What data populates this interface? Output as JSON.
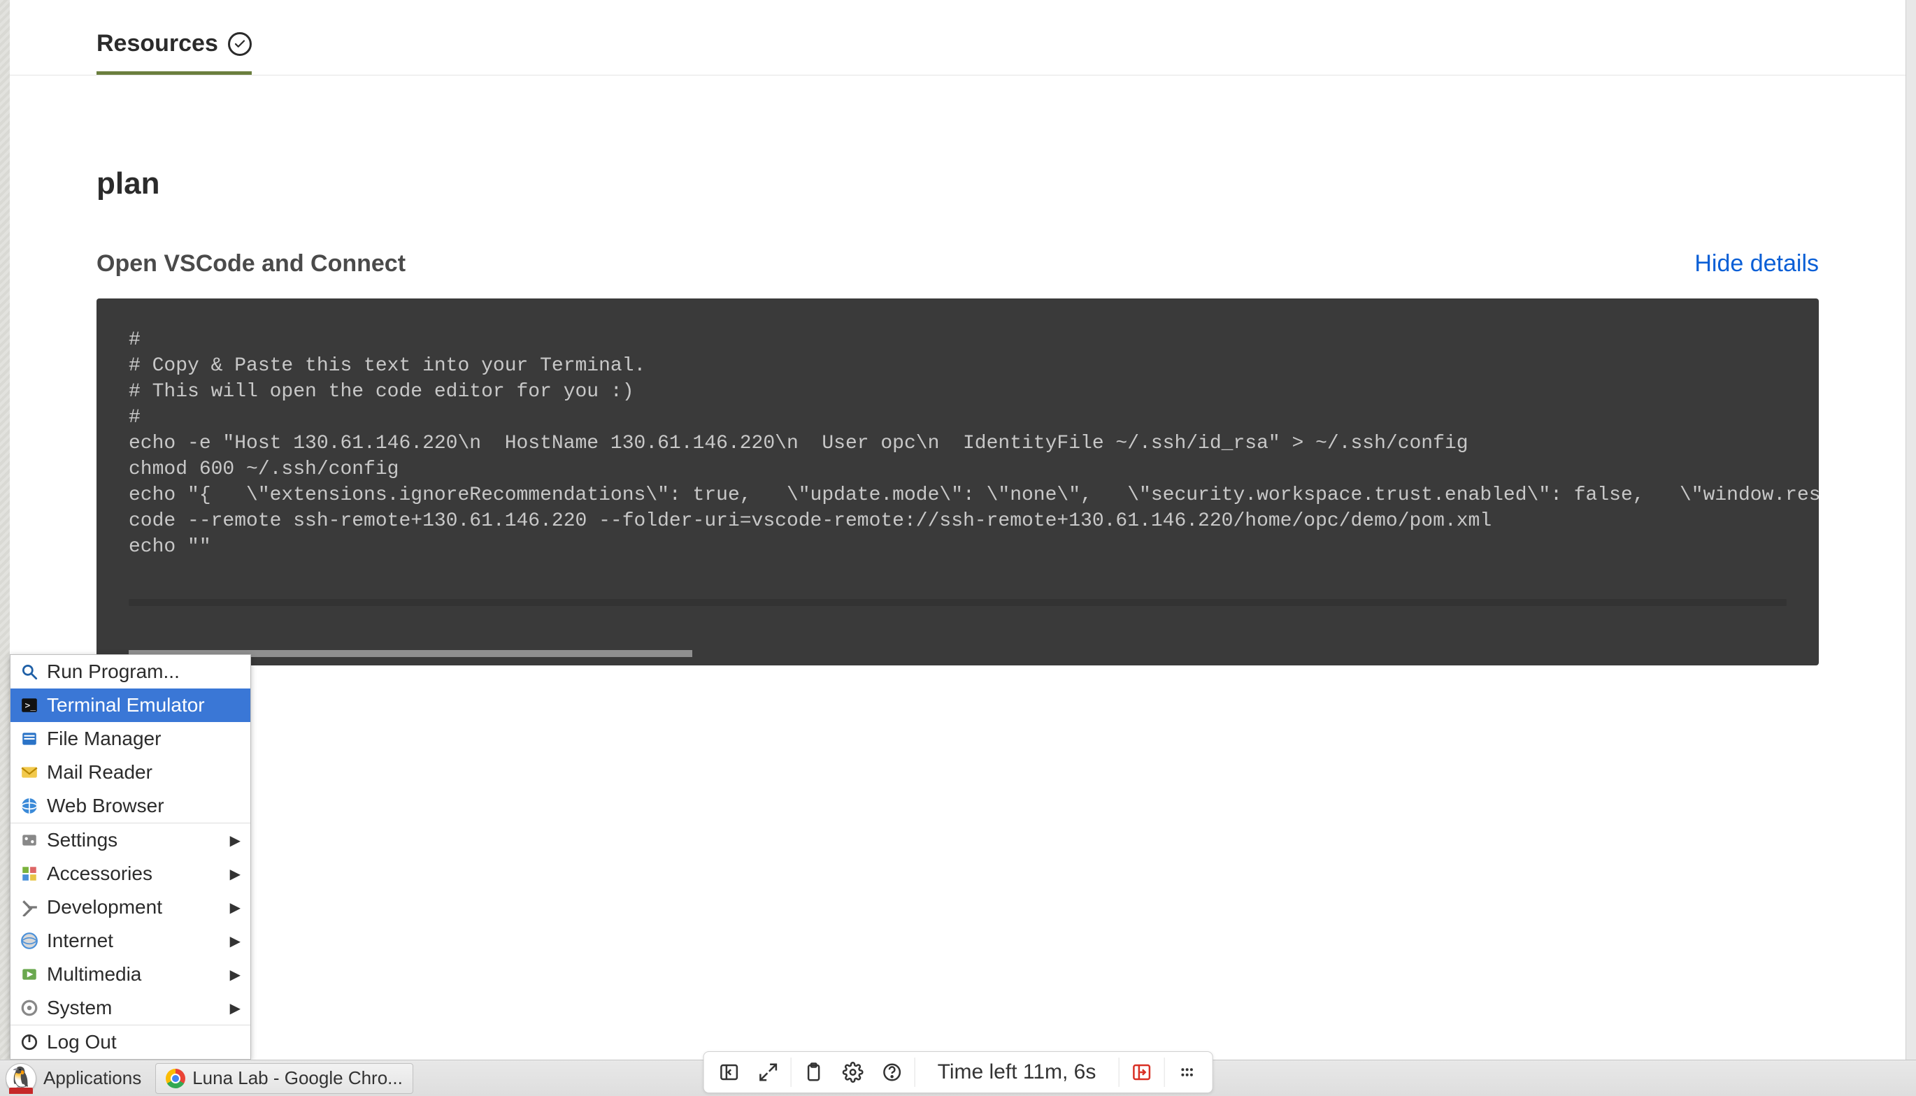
{
  "tabs": {
    "resources_label": "Resources"
  },
  "page": {
    "title": "plan",
    "step_title": "Open VSCode and Connect",
    "hide_details_label": "Hide details",
    "code": "#\n# Copy & Paste this text into your Terminal.\n# This will open the code editor for you :)\n#\necho -e \"Host 130.61.146.220\\n  HostName 130.61.146.220\\n  User opc\\n  IdentityFile ~/.ssh/id_rsa\" > ~/.ssh/config\nchmod 600 ~/.ssh/config\necho \"{   \\\"extensions.ignoreRecommendations\\\": true,   \\\"update.mode\\\": \\\"none\\\",   \\\"security.workspace.trust.enabled\\\": false,   \\\"window.restoreFu\ncode --remote ssh-remote+130.61.146.220 --folder-uri=vscode-remote://ssh-remote+130.61.146.220/home/opc/demo/pom.xml\necho \"\""
  },
  "app_menu": {
    "items": [
      {
        "label": "Run Program...",
        "submenu": false,
        "highlight": false,
        "icon": "search"
      },
      {
        "label": "Terminal Emulator",
        "submenu": false,
        "highlight": true,
        "icon": "terminal"
      },
      {
        "label": "File Manager",
        "submenu": false,
        "highlight": false,
        "icon": "file-manager"
      },
      {
        "label": "Mail Reader",
        "submenu": false,
        "highlight": false,
        "icon": "mail"
      },
      {
        "label": "Web Browser",
        "submenu": false,
        "highlight": false,
        "icon": "globe"
      },
      {
        "label": "Settings",
        "submenu": true,
        "highlight": false,
        "icon": "settings"
      },
      {
        "label": "Accessories",
        "submenu": true,
        "highlight": false,
        "icon": "accessories"
      },
      {
        "label": "Development",
        "submenu": true,
        "highlight": false,
        "icon": "development"
      },
      {
        "label": "Internet",
        "submenu": true,
        "highlight": false,
        "icon": "internet"
      },
      {
        "label": "Multimedia",
        "submenu": true,
        "highlight": false,
        "icon": "multimedia"
      },
      {
        "label": "System",
        "submenu": true,
        "highlight": false,
        "icon": "system"
      },
      {
        "label": "Log Out",
        "submenu": false,
        "highlight": false,
        "icon": "logout"
      }
    ]
  },
  "taskbar": {
    "applications_label": "Applications",
    "window_title": "Luna Lab - Google Chro..."
  },
  "control_bar": {
    "time_left": "Time left 11m, 6s"
  }
}
